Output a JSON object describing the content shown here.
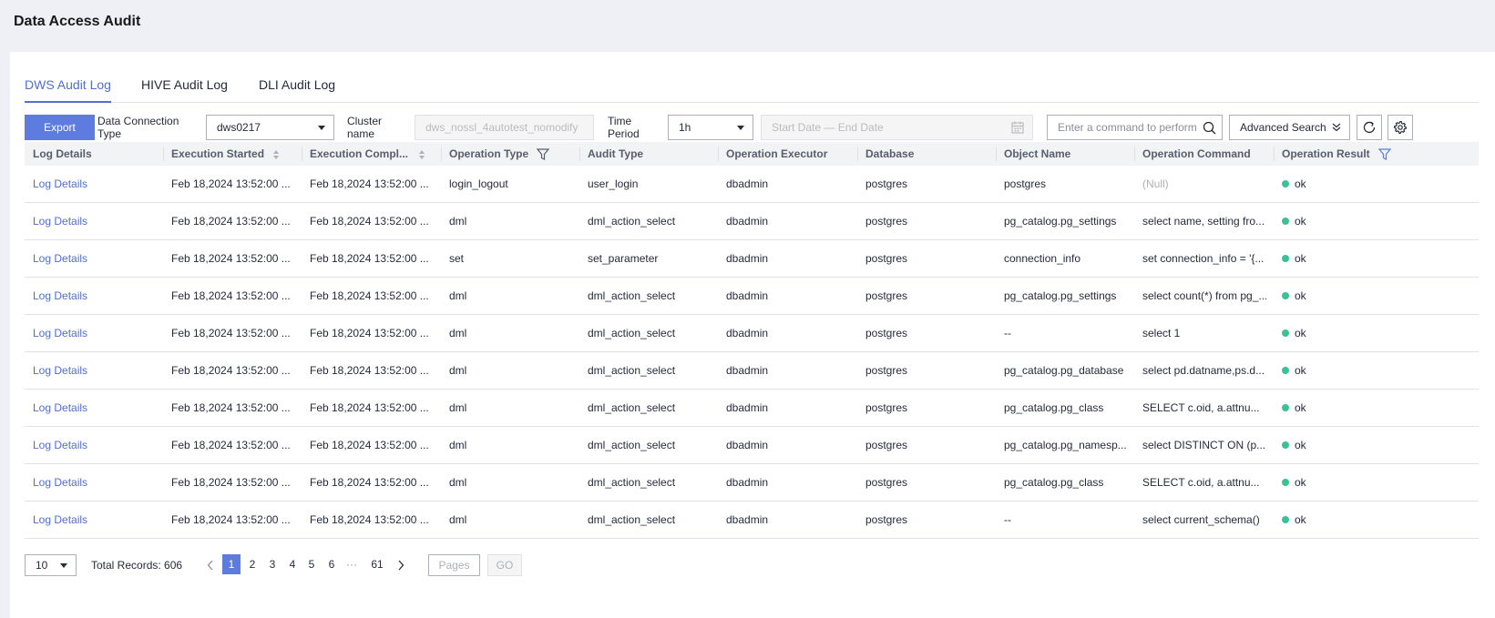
{
  "page": {
    "title": "Data Access Audit"
  },
  "tabs": [
    {
      "label": "DWS Audit Log",
      "active": true
    },
    {
      "label": "HIVE Audit Log",
      "active": false
    },
    {
      "label": "DLI Audit Log",
      "active": false
    }
  ],
  "toolbar": {
    "export_label": "Export",
    "connection_type_label_1": "Data Connection",
    "connection_type_label_2": "Type",
    "connection_value": "dws0217",
    "cluster_label_1": "Cluster",
    "cluster_label_2": "name",
    "cluster_value": "dws_nossl_4autotest_nomodify",
    "time_label_1": "Time",
    "time_label_2": "Period",
    "time_value": "1h",
    "date_range_placeholder": "Start Date — End Date",
    "search_placeholder": "Enter a command to perform",
    "advanced_search_label": "Advanced Search",
    "accent_color": "#5e7ce0"
  },
  "table": {
    "headers": [
      "Log Details",
      "Execution Started",
      "Execution Compl...",
      "Operation Type",
      "Audit Type",
      "Operation Executor",
      "Database",
      "Object Name",
      "Operation Command",
      "Operation Result"
    ],
    "rows": [
      {
        "details": "Log Details",
        "started": "Feb 18,2024 13:52:00 ...",
        "completed": "Feb 18,2024 13:52:00 ...",
        "op_type": "login_logout",
        "audit_type": "user_login",
        "executor": "dbadmin",
        "database": "postgres",
        "object": "postgres",
        "command": "(Null)",
        "result": "ok"
      },
      {
        "details": "Log Details",
        "started": "Feb 18,2024 13:52:00 ...",
        "completed": "Feb 18,2024 13:52:00 ...",
        "op_type": "dml",
        "audit_type": "dml_action_select",
        "executor": "dbadmin",
        "database": "postgres",
        "object": "pg_catalog.pg_settings",
        "command": "select name, setting fro...",
        "result": "ok"
      },
      {
        "details": "Log Details",
        "started": "Feb 18,2024 13:52:00 ...",
        "completed": "Feb 18,2024 13:52:00 ...",
        "op_type": "set",
        "audit_type": "set_parameter",
        "executor": "dbadmin",
        "database": "postgres",
        "object": "connection_info",
        "command": "set connection_info = '{...",
        "result": "ok"
      },
      {
        "details": "Log Details",
        "started": "Feb 18,2024 13:52:00 ...",
        "completed": "Feb 18,2024 13:52:00 ...",
        "op_type": "dml",
        "audit_type": "dml_action_select",
        "executor": "dbadmin",
        "database": "postgres",
        "object": "pg_catalog.pg_settings",
        "command": "select count(*) from pg_...",
        "result": "ok"
      },
      {
        "details": "Log Details",
        "started": "Feb 18,2024 13:52:00 ...",
        "completed": "Feb 18,2024 13:52:00 ...",
        "op_type": "dml",
        "audit_type": "dml_action_select",
        "executor": "dbadmin",
        "database": "postgres",
        "object": "--",
        "command": "select 1",
        "result": "ok"
      },
      {
        "details": "Log Details",
        "started": "Feb 18,2024 13:52:00 ...",
        "completed": "Feb 18,2024 13:52:00 ...",
        "op_type": "dml",
        "audit_type": "dml_action_select",
        "executor": "dbadmin",
        "database": "postgres",
        "object": "pg_catalog.pg_database",
        "command": "select pd.datname,ps.d...",
        "result": "ok"
      },
      {
        "details": "Log Details",
        "started": "Feb 18,2024 13:52:00 ...",
        "completed": "Feb 18,2024 13:52:00 ...",
        "op_type": "dml",
        "audit_type": "dml_action_select",
        "executor": "dbadmin",
        "database": "postgres",
        "object": "pg_catalog.pg_class",
        "command": "SELECT c.oid, a.attnu...",
        "result": "ok"
      },
      {
        "details": "Log Details",
        "started": "Feb 18,2024 13:52:00 ...",
        "completed": "Feb 18,2024 13:52:00 ...",
        "op_type": "dml",
        "audit_type": "dml_action_select",
        "executor": "dbadmin",
        "database": "postgres",
        "object": "pg_catalog.pg_namesp...",
        "command": "select DISTINCT ON (p...",
        "result": "ok"
      },
      {
        "details": "Log Details",
        "started": "Feb 18,2024 13:52:00 ...",
        "completed": "Feb 18,2024 13:52:00 ...",
        "op_type": "dml",
        "audit_type": "dml_action_select",
        "executor": "dbadmin",
        "database": "postgres",
        "object": "pg_catalog.pg_class",
        "command": "SELECT c.oid, a.attnu...",
        "result": "ok"
      },
      {
        "details": "Log Details",
        "started": "Feb 18,2024 13:52:00 ...",
        "completed": "Feb 18,2024 13:52:00 ...",
        "op_type": "dml",
        "audit_type": "dml_action_select",
        "executor": "dbadmin",
        "database": "postgres",
        "object": "--",
        "command": "select current_schema()",
        "result": "ok"
      }
    ]
  },
  "pager": {
    "page_size": "10",
    "total_label": "Total Records: 606",
    "pages": [
      "1",
      "2",
      "3",
      "4",
      "5",
      "6",
      "···",
      "61"
    ],
    "active_page": "1",
    "jump_placeholder": "Pages",
    "go_label": "GO"
  }
}
